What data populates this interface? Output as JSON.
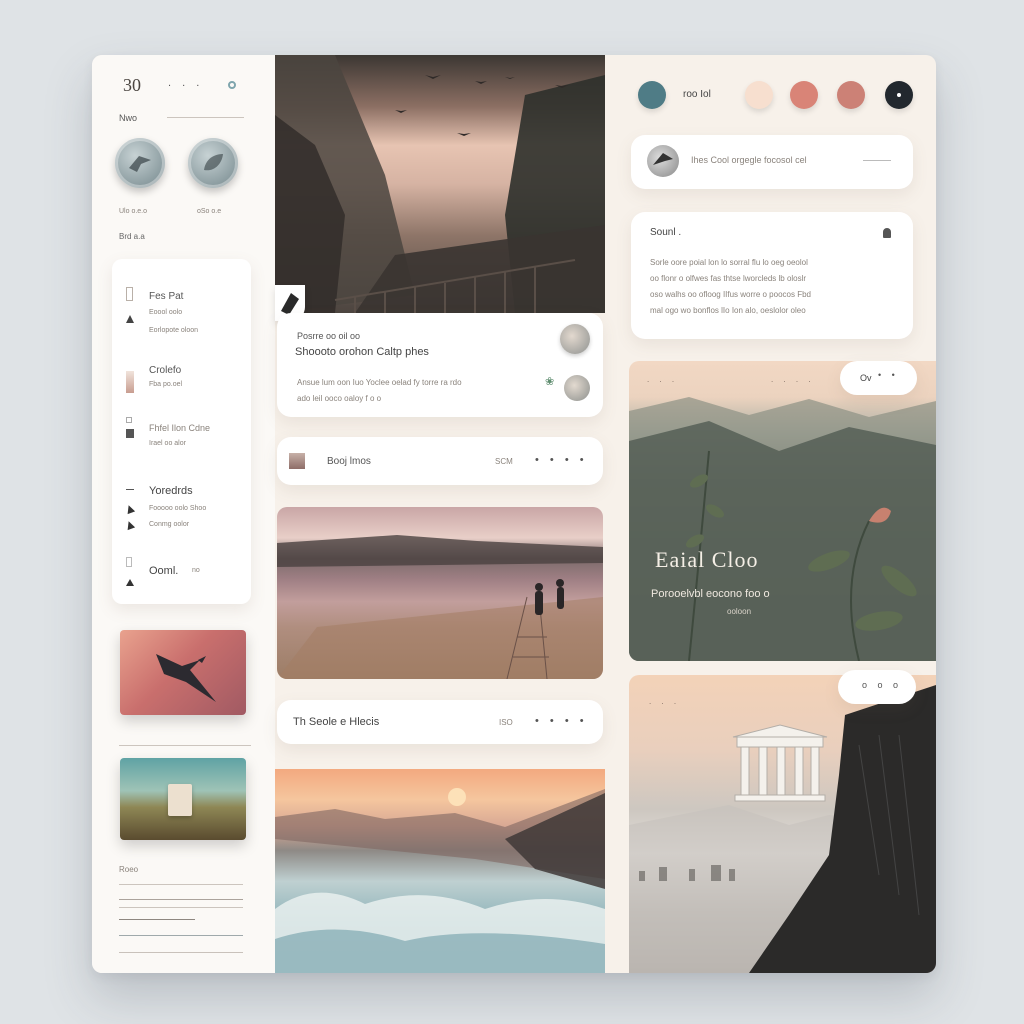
{
  "left": {
    "number": "30",
    "top_dots": ". . .",
    "section_label": "Nwo",
    "coin_captions": [
      "Ulo o.e.o",
      "oSo o.e"
    ],
    "small_label": "Brd a.a",
    "menu": [
      {
        "title": "Fes Pat",
        "sub1": "Eoool oolo",
        "sub2": "Eorlopote oloon"
      },
      {
        "title": "Crolefo",
        "sub1": "Fba po.oel"
      },
      {
        "title": "Fhfel Ilon Cdne",
        "sub1": "Irael oo alor"
      },
      {
        "title": "Yoredrds",
        "sub1": "Fooooo oolo Shoo",
        "sub2": "Conmg oolor"
      },
      {
        "title": "Ooml.",
        "sub1": "no"
      }
    ],
    "footer_label": "Roeo"
  },
  "middle": {
    "post": {
      "line1": "Posrre oo oil oo",
      "title": "Shoooto orohon Caltp phes",
      "body1": "Ansue lum oon Iuo Yoclee oelad fy torre ra rdo",
      "body2": "ado leil ooco oaloy f o o"
    },
    "book": {
      "label": "Booj  lmos",
      "meta": "SCM"
    },
    "search": {
      "label": "Th  Seole e Hlecis",
      "meta": "ISO"
    }
  },
  "right": {
    "top_label": "roo Iol",
    "colors": [
      "#4f7c86",
      "#f7dfcf",
      "#d98477",
      "#cc8176",
      "#22282e"
    ],
    "notif_text": "Ihes   Cool orgegle focosol cel",
    "sound": {
      "title": "Sounl .",
      "lines": [
        "Sorle oore poial lon lo sorral flu lo oeg oeolol",
        "oo flonr o olfwes fas thtse lworcleds lb oloslr",
        "oso walhs oo ofloog IIfus worre o poocos Fbd",
        "mal ogo wo bonflos  lIo Ion alo, oeslolor oleo"
      ]
    },
    "hero": {
      "pill": "Ov",
      "title": "Eaial Cloo",
      "sub": "Porooelvbl eocono foo o",
      "sub2": "ooloon"
    },
    "temple_pill": "o o o"
  }
}
